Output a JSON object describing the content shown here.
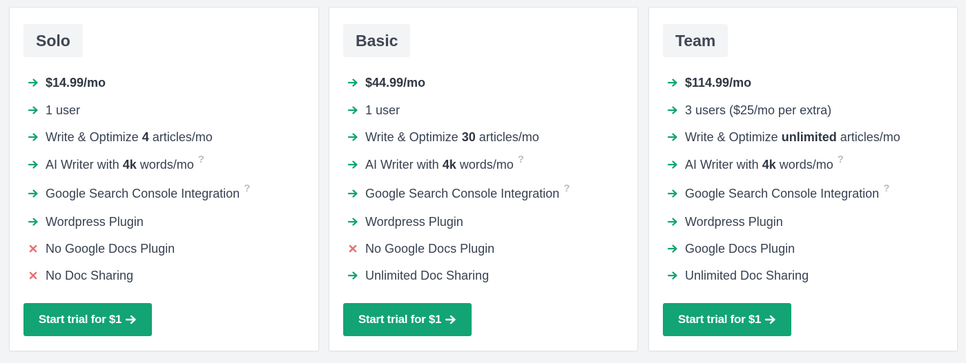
{
  "accent_color": "#12a474",
  "check_color": "#12a474",
  "cross_color": "#e57373",
  "plans": [
    {
      "name": "Solo",
      "features": [
        {
          "icon": "check",
          "pre": "",
          "bold": "$14.99/mo",
          "post": "",
          "help": false
        },
        {
          "icon": "check",
          "pre": "1 user",
          "bold": "",
          "post": "",
          "help": false
        },
        {
          "icon": "check",
          "pre": "Write & Optimize ",
          "bold": "4",
          "post": " articles/mo",
          "help": false
        },
        {
          "icon": "check",
          "pre": "AI Writer with ",
          "bold": "4k",
          "post": " words/mo",
          "help": true
        },
        {
          "icon": "check",
          "pre": "Google Search Console Integration",
          "bold": "",
          "post": "",
          "help": true
        },
        {
          "icon": "check",
          "pre": "Wordpress Plugin",
          "bold": "",
          "post": "",
          "help": false
        },
        {
          "icon": "cross",
          "pre": "No Google Docs Plugin",
          "bold": "",
          "post": "",
          "help": false
        },
        {
          "icon": "cross",
          "pre": "No Doc Sharing",
          "bold": "",
          "post": "",
          "help": false
        }
      ],
      "cta": "Start trial for $1"
    },
    {
      "name": "Basic",
      "features": [
        {
          "icon": "check",
          "pre": "",
          "bold": "$44.99/mo",
          "post": "",
          "help": false
        },
        {
          "icon": "check",
          "pre": "1 user",
          "bold": "",
          "post": "",
          "help": false
        },
        {
          "icon": "check",
          "pre": "Write & Optimize ",
          "bold": "30",
          "post": " articles/mo",
          "help": false
        },
        {
          "icon": "check",
          "pre": "AI Writer with ",
          "bold": "4k",
          "post": " words/mo",
          "help": true
        },
        {
          "icon": "check",
          "pre": "Google Search Console Integration",
          "bold": "",
          "post": "",
          "help": true
        },
        {
          "icon": "check",
          "pre": "Wordpress Plugin",
          "bold": "",
          "post": "",
          "help": false
        },
        {
          "icon": "cross",
          "pre": "No Google Docs Plugin",
          "bold": "",
          "post": "",
          "help": false
        },
        {
          "icon": "check",
          "pre": "Unlimited Doc Sharing",
          "bold": "",
          "post": "",
          "help": false
        }
      ],
      "cta": "Start trial for $1"
    },
    {
      "name": "Team",
      "features": [
        {
          "icon": "check",
          "pre": "",
          "bold": "$114.99/mo",
          "post": "",
          "help": false
        },
        {
          "icon": "check",
          "pre": "3 users ($25/mo per extra)",
          "bold": "",
          "post": "",
          "help": false
        },
        {
          "icon": "check",
          "pre": "Write & Optimize ",
          "bold": "unlimited",
          "post": " articles/mo",
          "help": false
        },
        {
          "icon": "check",
          "pre": "AI Writer with ",
          "bold": "4k",
          "post": " words/mo",
          "help": true
        },
        {
          "icon": "check",
          "pre": "Google Search Console Integration",
          "bold": "",
          "post": "",
          "help": true
        },
        {
          "icon": "check",
          "pre": "Wordpress Plugin",
          "bold": "",
          "post": "",
          "help": false
        },
        {
          "icon": "check",
          "pre": "Google Docs Plugin",
          "bold": "",
          "post": "",
          "help": false
        },
        {
          "icon": "check",
          "pre": "Unlimited Doc Sharing",
          "bold": "",
          "post": "",
          "help": false
        }
      ],
      "cta": "Start trial for $1"
    }
  ],
  "help_glyph": "?"
}
